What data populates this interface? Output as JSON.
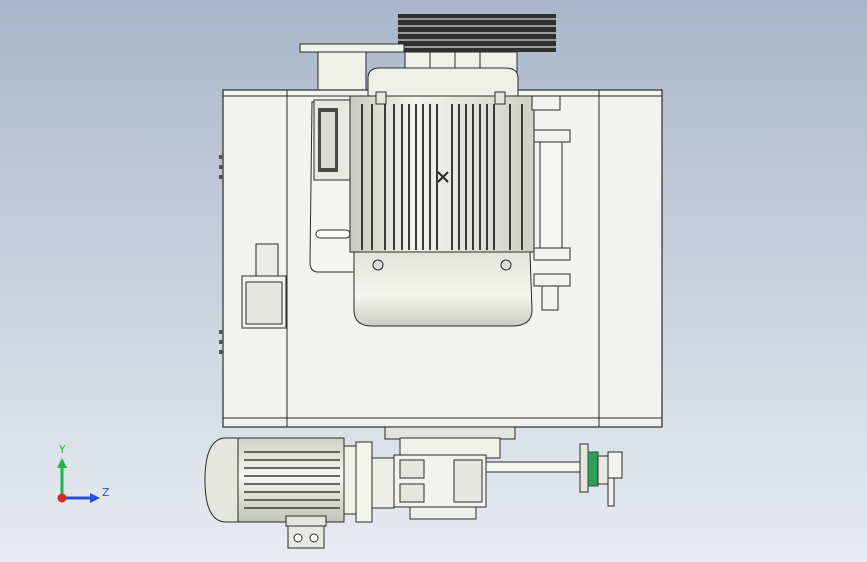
{
  "window": {
    "background_top": "#a9b6cb",
    "background_bottom": "#e9ecf1"
  },
  "colors": {
    "outline": "#2a2a2a",
    "housing": "#f2f2ef",
    "motor_body": "#e8e8e2",
    "motor_shadow": "#c9cac0",
    "fin": "#3a3a3a",
    "pulley": "#9a9a9a",
    "green_flange": "#2e9e5c",
    "axis_x": "#d92626",
    "axis_y": "#20b24a",
    "axis_z": "#2a50d8"
  },
  "triad": {
    "y_label": "Y",
    "z_label": "Z",
    "x_icon": "axis-origin-icon"
  }
}
